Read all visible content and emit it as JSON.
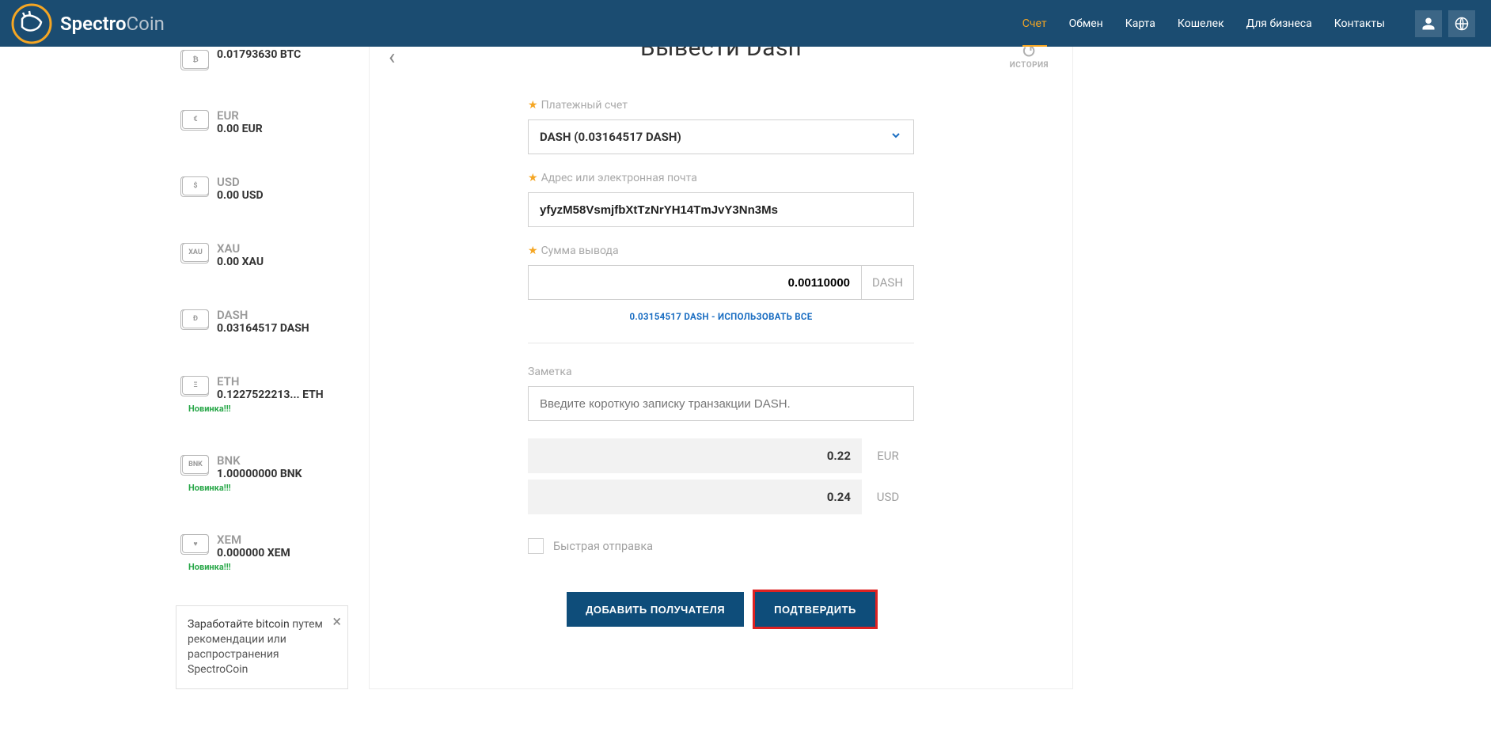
{
  "brand": {
    "name1": "Spectro",
    "name2": "Coin"
  },
  "nav": {
    "items": [
      "Счет",
      "Обмен",
      "Карта",
      "Кошелек",
      "Для бизнеса",
      "Контакты"
    ],
    "active_index": 0
  },
  "wallets": [
    {
      "currency": "BTC",
      "label": "",
      "balance": "0.01793630 BTC",
      "icon_text": "₿",
      "new": false
    },
    {
      "currency": "EUR",
      "label": "EUR",
      "balance": "0.00 EUR",
      "icon_text": "€",
      "new": false
    },
    {
      "currency": "USD",
      "label": "USD",
      "balance": "0.00 USD",
      "icon_text": "$",
      "new": false
    },
    {
      "currency": "XAU",
      "label": "XAU",
      "balance": "0.00 XAU",
      "icon_text": "XAU",
      "new": false
    },
    {
      "currency": "DASH",
      "label": "DASH",
      "balance": "0.03164517 DASH",
      "icon_text": "Đ",
      "new": false
    },
    {
      "currency": "ETH",
      "label": "ETH",
      "balance": "0.1227522213... ETH",
      "icon_text": "Ξ",
      "new": true
    },
    {
      "currency": "BNK",
      "label": "BNK",
      "balance": "1.00000000 BNK",
      "icon_text": "BNK",
      "new": true
    },
    {
      "currency": "XEM",
      "label": "XEM",
      "balance": "0.000000 XEM",
      "icon_text": "♥",
      "new": true
    }
  ],
  "new_badge": "Новинка!!!",
  "promo": {
    "title": "Заработайте bitcoin",
    "text": "путем рекомендации или распространения SpectroCoin"
  },
  "page": {
    "title": "Вывести Dash",
    "history_label": "ИСТОРИЯ"
  },
  "form": {
    "account_label": "Платежный счет",
    "account_value": "DASH (0.03164517 DASH)",
    "address_label": "Адрес или электронная почта",
    "address_value": "yfyzM58VsmjfbXtTzNrYH14TmJvY3Nn3Ms",
    "amount_label": "Сумма вывода",
    "amount_value": "0.00110000",
    "amount_unit": "DASH",
    "use_all": "0.03154517 DASH - ИСПОЛЬЗОВАТЬ ВСЕ",
    "note_label": "Заметка",
    "note_placeholder": "Введите короткую записку транзакции DASH.",
    "conversions": [
      {
        "value": "0.22",
        "unit": "EUR"
      },
      {
        "value": "0.24",
        "unit": "USD"
      }
    ],
    "fast_send": "Быстрая отправка",
    "btn_add": "ДОБАВИТЬ ПОЛУЧАТЕЛЯ",
    "btn_confirm": "ПОДТВЕРДИТЬ"
  }
}
